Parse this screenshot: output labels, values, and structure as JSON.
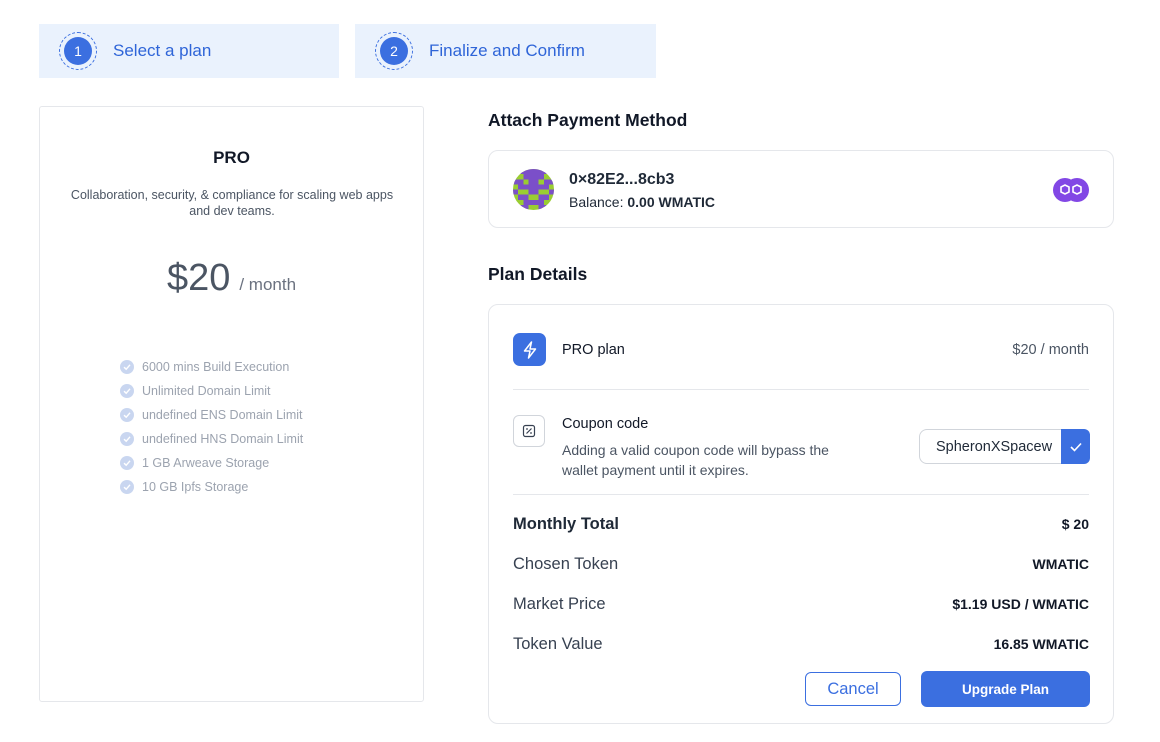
{
  "stepper": {
    "steps": [
      {
        "number": "1",
        "label": "Select a plan"
      },
      {
        "number": "2",
        "label": "Finalize and Confirm"
      }
    ]
  },
  "plan": {
    "name": "PRO",
    "description": "Collaboration, security, & compliance for scaling web apps and dev teams.",
    "price": "$20",
    "period": "/ month",
    "features": [
      "6000 mins Build Execution",
      "Unlimited Domain Limit",
      "undefined ENS Domain Limit",
      "undefined HNS Domain Limit",
      "1 GB Arweave Storage",
      "10 GB Ipfs Storage"
    ]
  },
  "payment": {
    "title": "Attach Payment Method",
    "wallet_address": "0×82E2...8cb3",
    "balance_label": "Balance:",
    "balance_value": "0.00 WMATIC"
  },
  "details": {
    "title": "Plan Details",
    "plan_label": "PRO plan",
    "plan_price": "$20 / month",
    "coupon_title": "Coupon code",
    "coupon_desc": "Adding a valid coupon code will bypass the wallet payment until it expires.",
    "coupon_value": "SpheronXSpacew",
    "summary": [
      {
        "label": "Monthly Total",
        "value": "$ 20"
      },
      {
        "label": "Chosen Token",
        "value": "WMATIC"
      },
      {
        "label": "Market Price",
        "value": "$1.19 USD / WMATIC"
      },
      {
        "label": "Token Value",
        "value": "16.85 WMATIC"
      }
    ],
    "cancel_label": "Cancel",
    "upgrade_label": "Upgrade Plan"
  },
  "colors": {
    "accent": "#3b6fe0",
    "step_bg": "#eaf2fd",
    "chain": "#8247e5"
  }
}
